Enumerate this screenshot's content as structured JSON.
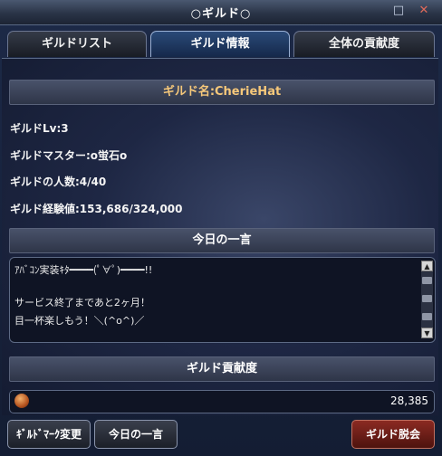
{
  "window": {
    "title": "○ギルド○",
    "minimize_icon": "□",
    "close_icon": "✕"
  },
  "tabs": [
    {
      "label": "ギルドリスト",
      "active": false
    },
    {
      "label": "ギルド情報",
      "active": true
    },
    {
      "label": "全体の貢献度",
      "active": false
    }
  ],
  "guild": {
    "name_label": "ギルド名:CherieHat",
    "level": "ギルドLv:3",
    "master": "ギルドマスター:o蛍石o",
    "members": "ギルドの人数:4/40",
    "exp": "ギルド経験値:153,686/324,000"
  },
  "message": {
    "header": "今日の一言",
    "lines": [
      "ｱﾊﾞｺﾝ実装ｷﾀ━━━━(ﾟ∀ﾟ)━━━━!!",
      "",
      "サービス終了まであと2ヶ月！",
      "目一杯楽しもう！＼(^o^)／"
    ]
  },
  "contribution": {
    "header": "ギルド貢献度",
    "value": "28,385"
  },
  "buttons": {
    "mark_change": "ｷﾞﾙﾄﾞﾏｰｸ変更",
    "daily_message": "今日の一言",
    "leave": "ギルド脱会"
  },
  "colors": {
    "accent": "#f6c87a",
    "leave_button": "#8b2a22",
    "active_tab": "#2a4a78"
  }
}
